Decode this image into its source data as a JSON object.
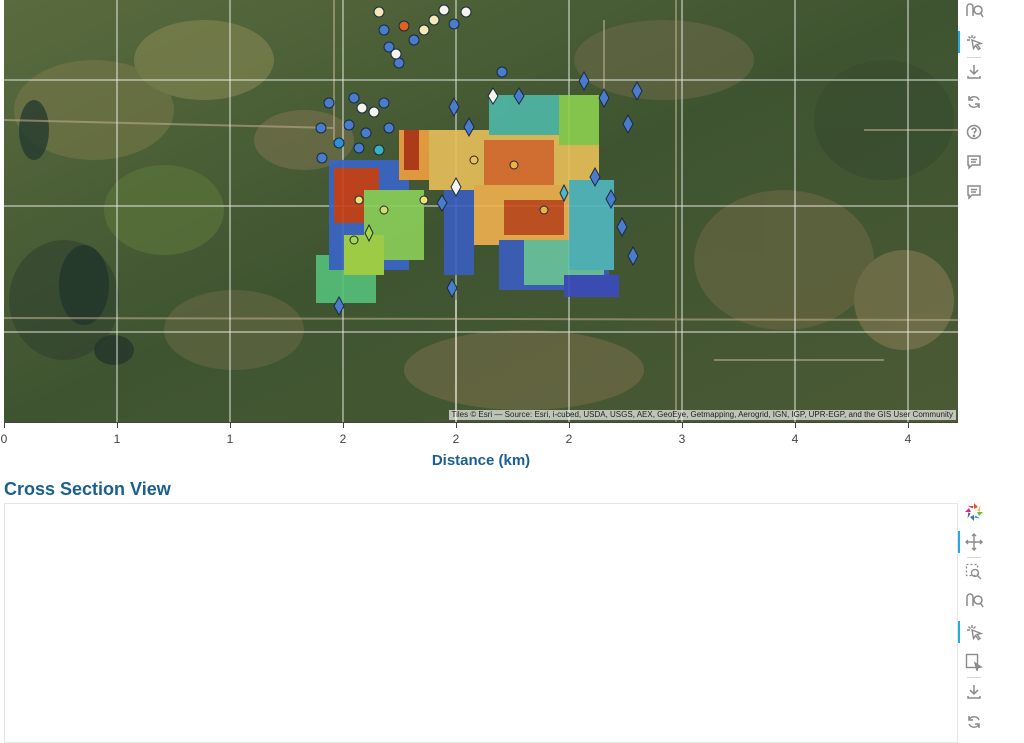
{
  "map": {
    "attribution": "Tiles © Esri — Source: Esri, i-cubed, USDA, USGS, AEX, GeoEye, Getmapping, Aerogrid, IGN, IGP, UPR-EGP, and the GIS User Community",
    "x_axis": {
      "title": "Distance (km)",
      "ticks": [
        "0",
        "1",
        "1",
        "2",
        "2",
        "2",
        "3",
        "4",
        "4"
      ]
    }
  },
  "map_toolbar": {
    "icons": [
      "wheel-zoom-icon",
      "tap-select-icon",
      "save-icon",
      "reset-icon",
      "help-icon",
      "comment-icon",
      "comment-icon"
    ]
  },
  "cross_section": {
    "title": "Cross Section View"
  },
  "cross_toolbar": {
    "icons": [
      "bokeh-logo-icon",
      "pan-icon",
      "box-zoom-icon",
      "wheel-zoom-icon",
      "tap-select-icon",
      "box-edit-icon",
      "save-icon",
      "reset-icon"
    ]
  },
  "colors": {
    "title": "#1a5f8f",
    "accent": "#26aae1",
    "heat_low": "#3b4cc0",
    "heat_high": "#c8401a"
  }
}
